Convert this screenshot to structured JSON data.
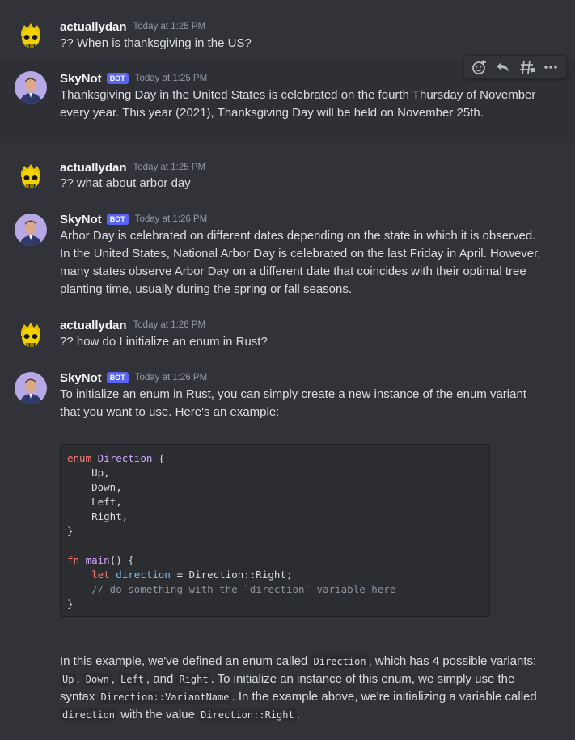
{
  "messages": [
    {
      "author": "actuallydan",
      "time": "Today at 1:25 PM",
      "text": "?? When is thanksgiving in the US?"
    },
    {
      "author": "SkyNot",
      "bot": "BOT",
      "time": "Today at 1:25 PM",
      "text": "Thanksgiving Day in the United States is celebrated on the fourth Thursday of November every year. This year (2021), Thanksgiving Day will be held on November 25th."
    },
    {
      "author": "actuallydan",
      "time": "Today at 1:25 PM",
      "text": "?? what about arbor day"
    },
    {
      "author": "SkyNot",
      "bot": "BOT",
      "time": "Today at 1:26 PM",
      "text": "Arbor Day is celebrated on different dates depending on the state in which it is observed. In the United States, National Arbor Day is celebrated on the last Friday in April. However, many states observe Arbor Day on a different date that coincides with their optimal tree planting time, usually during the spring or fall seasons."
    },
    {
      "author": "actuallydan",
      "time": "Today at 1:26 PM",
      "text": "?? how do I initialize an enum in Rust?"
    },
    {
      "author": "SkyNot",
      "bot": "BOT",
      "time": "Today at 1:26 PM",
      "text": "To initialize an enum in Rust, you can simply create a new instance of the enum variant that you want to use. Here's an example:"
    }
  ],
  "code": {
    "l1_kw": "enum",
    "l1_ty": "Direction",
    "l1_rest": " {",
    "l2": "    Up,",
    "l3": "    Down,",
    "l4": "    Left,",
    "l5": "    Right,",
    "l6": "}",
    "l8_kw": "fn",
    "l8_fn": "main",
    "l8_rest": "() {",
    "l9_ind": "    ",
    "l9_kw": "let",
    "l9_var": "direction",
    "l9_rest": " = Direction::Right;",
    "l10": "    // do something with the `direction` variable here",
    "l11": "}"
  },
  "explain": {
    "p1": "In this example, we've defined an enum called ",
    "c1": "Direction",
    "p2": ", which has 4 possible variants: ",
    "c2": "Up",
    "p3": ", ",
    "c3": "Down",
    "p4": ", ",
    "c4": "Left",
    "p5": ", and ",
    "c5": "Right",
    "p6": ". To initialize an instance of this enum, we simply use the syntax ",
    "c6": "Direction::VariantName",
    "p7": ". In the example above, we're initializing a variable called ",
    "c7": "direction",
    "p8": " with the value ",
    "c8": "Direction::Right",
    "p9": "."
  },
  "toolbar": {
    "icons": [
      "add-reaction-icon",
      "reply-icon",
      "create-thread-icon",
      "more-icon"
    ]
  },
  "colors": {
    "background": "#313338",
    "bot_badge": "#5865f2",
    "username": "#f2f3f5"
  }
}
